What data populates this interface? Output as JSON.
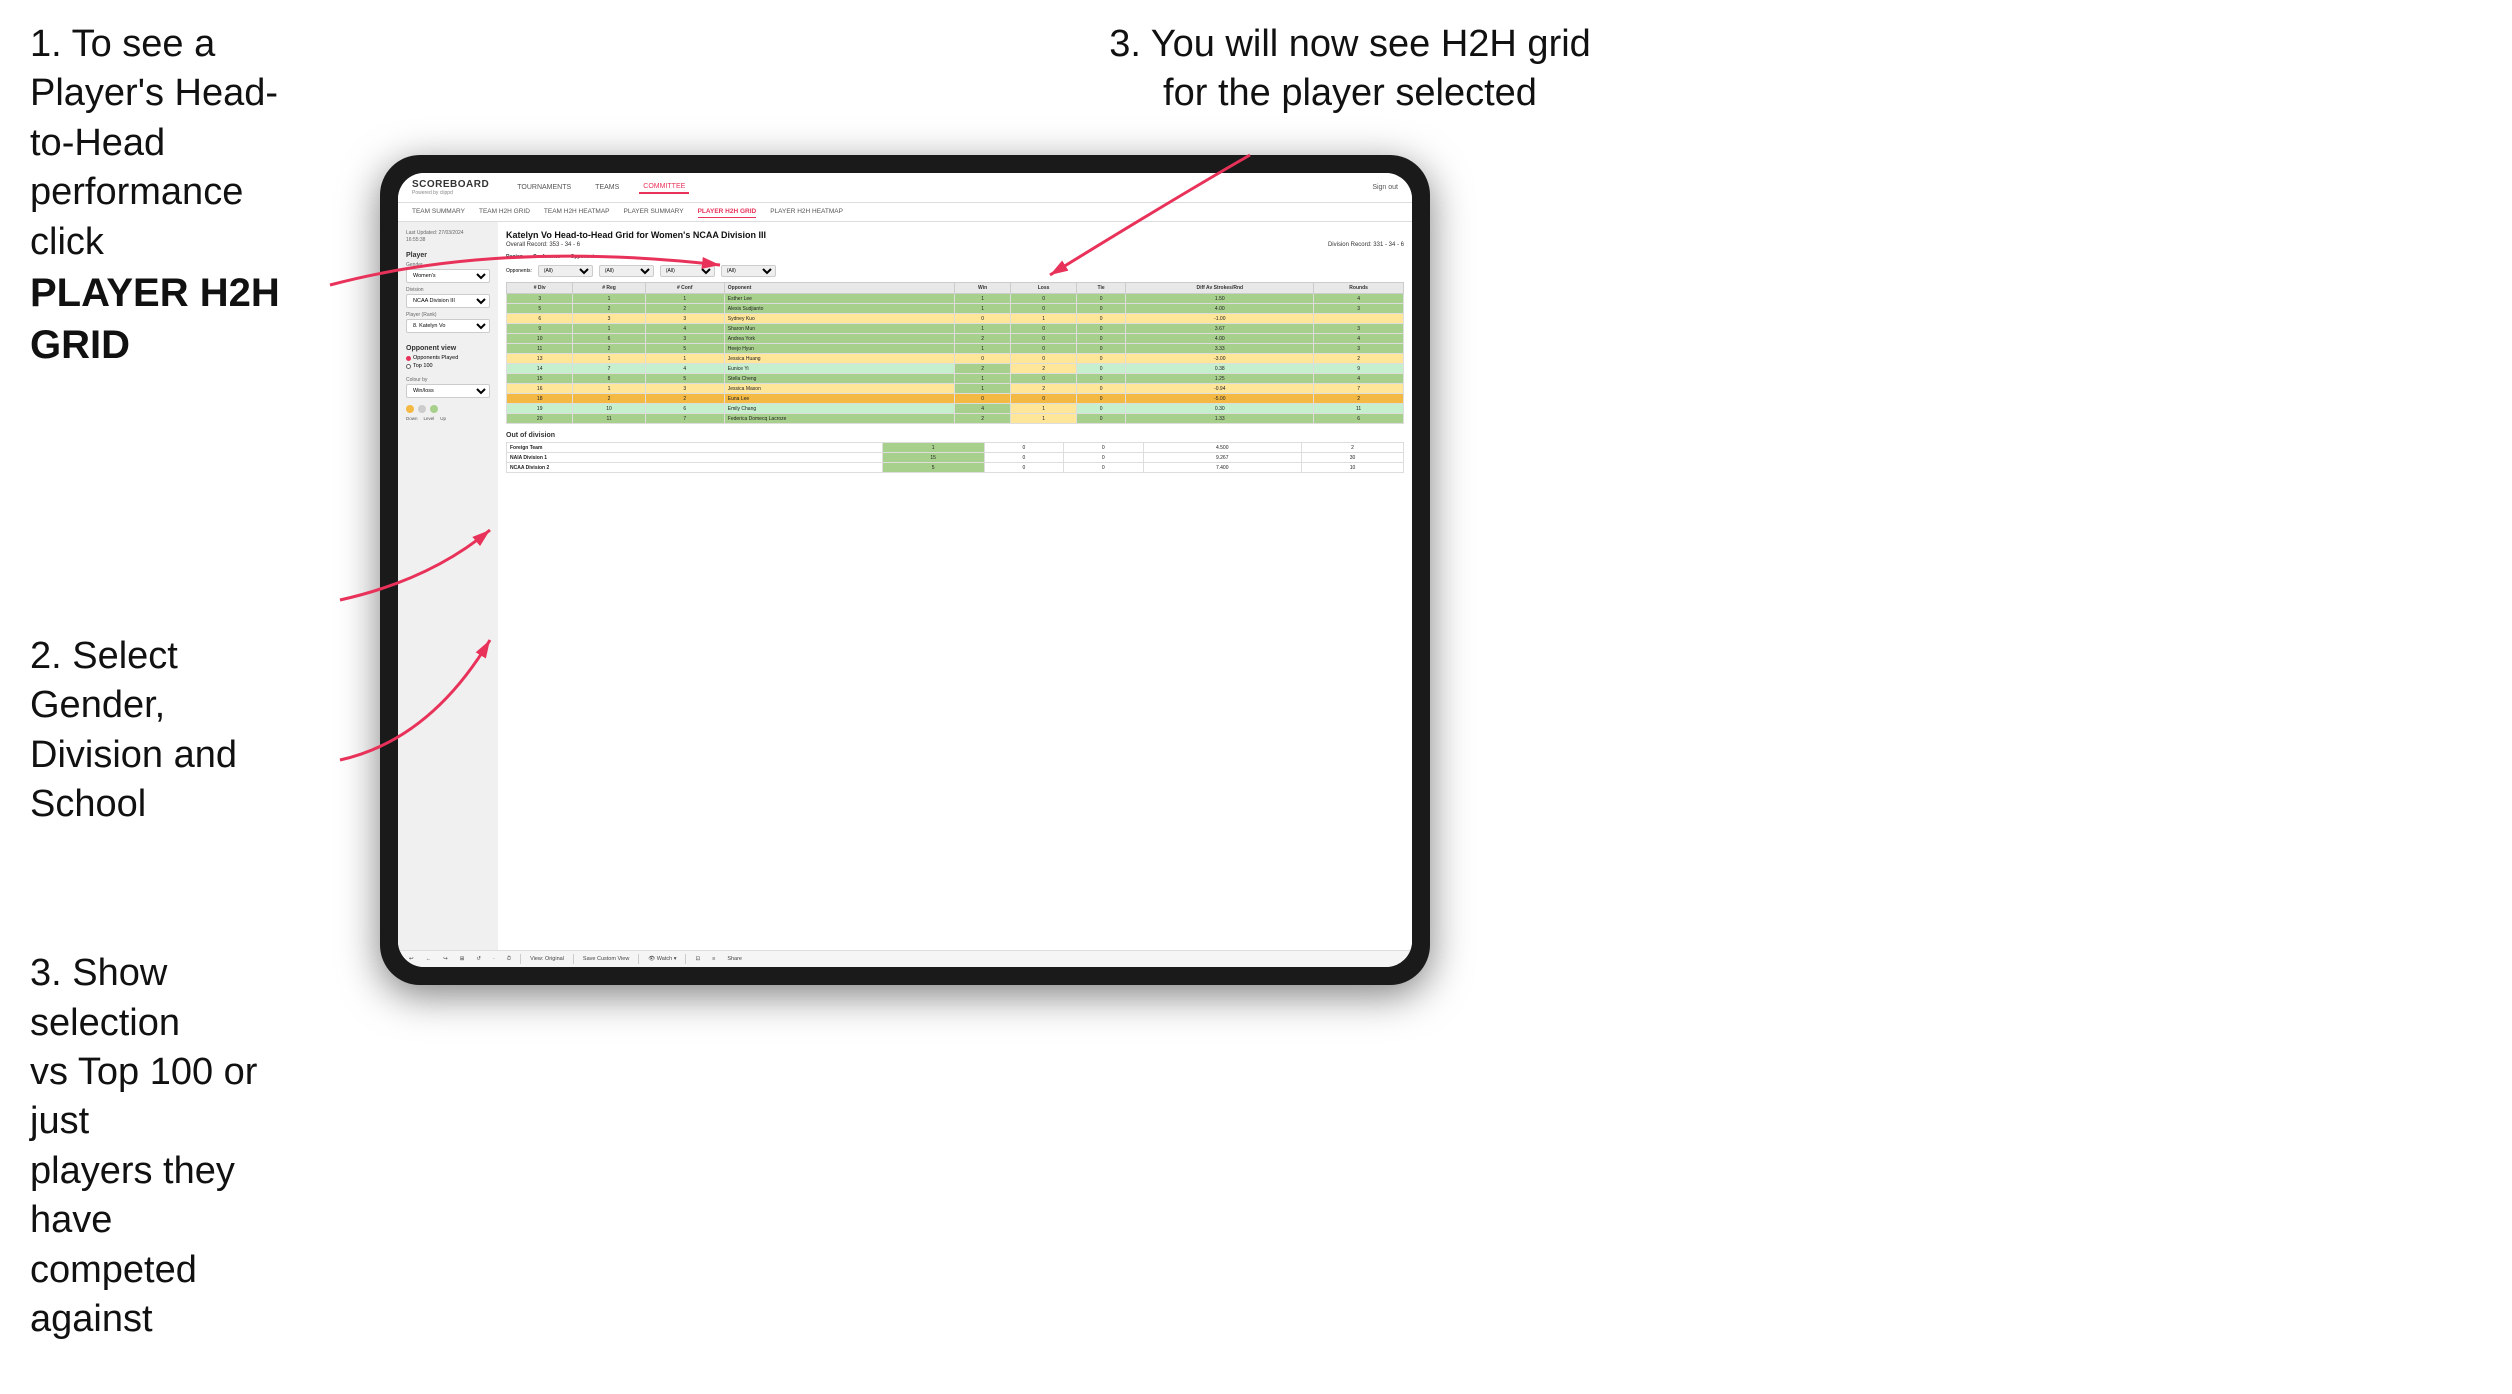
{
  "instructions": {
    "step1_line1": "1. To see a Player's Head-",
    "step1_line2": "to-Head performance click",
    "step1_bold": "PLAYER H2H GRID",
    "step2_line1": "2. Select Gender,",
    "step2_line2": "Division and",
    "step2_line3": "School",
    "step3a_line1": "3. Show selection",
    "step3a_line2": "vs Top 100 or just",
    "step3a_line3": "players they have",
    "step3a_line4": "competed against",
    "top_right_line1": "3. You will now see H2H grid",
    "top_right_line2": "for the player selected"
  },
  "nav": {
    "logo": "SCOREBOARD",
    "logo_sub": "Powered by clippd",
    "items": [
      "TOURNAMENTS",
      "TEAMS",
      "COMMITTEE"
    ],
    "sign_out": "Sign out"
  },
  "sub_nav": {
    "items": [
      "TEAM SUMMARY",
      "TEAM H2H GRID",
      "TEAM H2H HEATMAP",
      "PLAYER SUMMARY",
      "PLAYER H2H GRID",
      "PLAYER H2H HEATMAP"
    ],
    "active": "PLAYER H2H GRID"
  },
  "sidebar": {
    "last_updated": "Last Updated: 27/03/2024\n16:55:38",
    "player_section": "Player",
    "gender_label": "Gender",
    "gender_value": "Women's",
    "division_label": "Division",
    "division_value": "NCAA Division III",
    "player_rank_label": "Player (Rank)",
    "player_rank_value": "8. Katelyn Vo",
    "opponent_view_title": "Opponent view",
    "radio_options": [
      "Opponents Played",
      "Top 100"
    ],
    "radio_selected": "Opponents Played",
    "colour_by": "Colour by",
    "colour_by_value": "Win/loss",
    "colour_down": "Down",
    "colour_level": "Level",
    "colour_up": "Up"
  },
  "content": {
    "page_title": "Katelyn Vo Head-to-Head Grid for Women's NCAA Division III",
    "overall_record": "Overall Record: 353 - 34 - 6",
    "division_record": "Division Record: 331 - 34 - 6",
    "filters": {
      "opponents_label": "Opponents:",
      "region_label": "Region",
      "conference_label": "Conference",
      "opponent_label": "Opponent",
      "all_option": "(All)"
    },
    "table_headers": [
      "# Div",
      "# Reg",
      "# Conf",
      "Opponent",
      "Win",
      "Loss",
      "Tie",
      "Diff Av Strokes/Rnd",
      "Rounds"
    ],
    "table_rows": [
      {
        "div": 3,
        "reg": 1,
        "conf": 1,
        "opponent": "Esther Lee",
        "win": 1,
        "loss": 0,
        "tie": 0,
        "diff": 1.5,
        "rounds": 4,
        "color": "green"
      },
      {
        "div": 5,
        "reg": 2,
        "conf": 2,
        "opponent": "Alexis Sudjianto",
        "win": 1,
        "loss": 0,
        "tie": 0,
        "diff": 4.0,
        "rounds": 3,
        "color": "green"
      },
      {
        "div": 6,
        "reg": 3,
        "conf": 3,
        "opponent": "Sydney Kuo",
        "win": 0,
        "loss": 1,
        "tie": 0,
        "diff": -1.0,
        "rounds": "",
        "color": "yellow"
      },
      {
        "div": 9,
        "reg": 1,
        "conf": 4,
        "opponent": "Sharon Mun",
        "win": 1,
        "loss": 0,
        "tie": 0,
        "diff": 3.67,
        "rounds": 3,
        "color": "green"
      },
      {
        "div": 10,
        "reg": 6,
        "conf": 3,
        "opponent": "Andrea York",
        "win": 2,
        "loss": 0,
        "tie": 0,
        "diff": 4.0,
        "rounds": 4,
        "color": "green"
      },
      {
        "div": 11,
        "reg": 2,
        "conf": 5,
        "opponent": "Heejo Hyun",
        "win": 1,
        "loss": 0,
        "tie": 0,
        "diff": 3.33,
        "rounds": 3,
        "color": "green"
      },
      {
        "div": 13,
        "reg": 1,
        "conf": 1,
        "opponent": "Jessica Huang",
        "win": 0,
        "loss": 0,
        "tie": 0,
        "diff": -3.0,
        "rounds": 2,
        "color": "yellow"
      },
      {
        "div": 14,
        "reg": 7,
        "conf": 4,
        "opponent": "Eunice Yi",
        "win": 2,
        "loss": 2,
        "tie": 0,
        "diff": 0.38,
        "rounds": 9,
        "color": "light-green"
      },
      {
        "div": 15,
        "reg": 8,
        "conf": 5,
        "opponent": "Stella Cheng",
        "win": 1,
        "loss": 0,
        "tie": 0,
        "diff": 1.25,
        "rounds": 4,
        "color": "green"
      },
      {
        "div": 16,
        "reg": 1,
        "conf": 3,
        "opponent": "Jessica Mason",
        "win": 1,
        "loss": 2,
        "tie": 0,
        "diff": -0.94,
        "rounds": 7,
        "color": "yellow"
      },
      {
        "div": 18,
        "reg": 2,
        "conf": 2,
        "opponent": "Euna Lee",
        "win": 0,
        "loss": 0,
        "tie": 0,
        "diff": -5.0,
        "rounds": 2,
        "color": "orange"
      },
      {
        "div": 19,
        "reg": 10,
        "conf": 6,
        "opponent": "Emily Chang",
        "win": 4,
        "loss": 1,
        "tie": 0,
        "diff": 0.3,
        "rounds": 11,
        "color": "light-green"
      },
      {
        "div": 20,
        "reg": 11,
        "conf": 7,
        "opponent": "Federica Domecq Lacroze",
        "win": 2,
        "loss": 1,
        "tie": 0,
        "diff": 1.33,
        "rounds": 6,
        "color": "green"
      }
    ],
    "out_of_division_title": "Out of division",
    "out_of_division_rows": [
      {
        "name": "Foreign Team",
        "win": 1,
        "loss": 0,
        "tie": 0,
        "diff": 4.5,
        "rounds": 2
      },
      {
        "name": "NAIA Division 1",
        "win": 15,
        "loss": 0,
        "tie": 0,
        "diff": 9.267,
        "rounds": 30
      },
      {
        "name": "NCAA Division 2",
        "win": 5,
        "loss": 0,
        "tie": 0,
        "diff": 7.4,
        "rounds": 10
      }
    ]
  },
  "toolbar": {
    "buttons": [
      "↩",
      "←",
      "↪",
      "⊞",
      "↺",
      "·",
      "⏱",
      "View: Original",
      "Save Custom View",
      "👁 Watch ▾",
      "⊡",
      "≡",
      "Share"
    ]
  },
  "colors": {
    "active_tab": "#e8325a",
    "green_row": "#a8d08d",
    "yellow_row": "#ffe699",
    "light_green_row": "#c6efce",
    "orange_row": "#f4b942",
    "brand": "#e8325a"
  }
}
